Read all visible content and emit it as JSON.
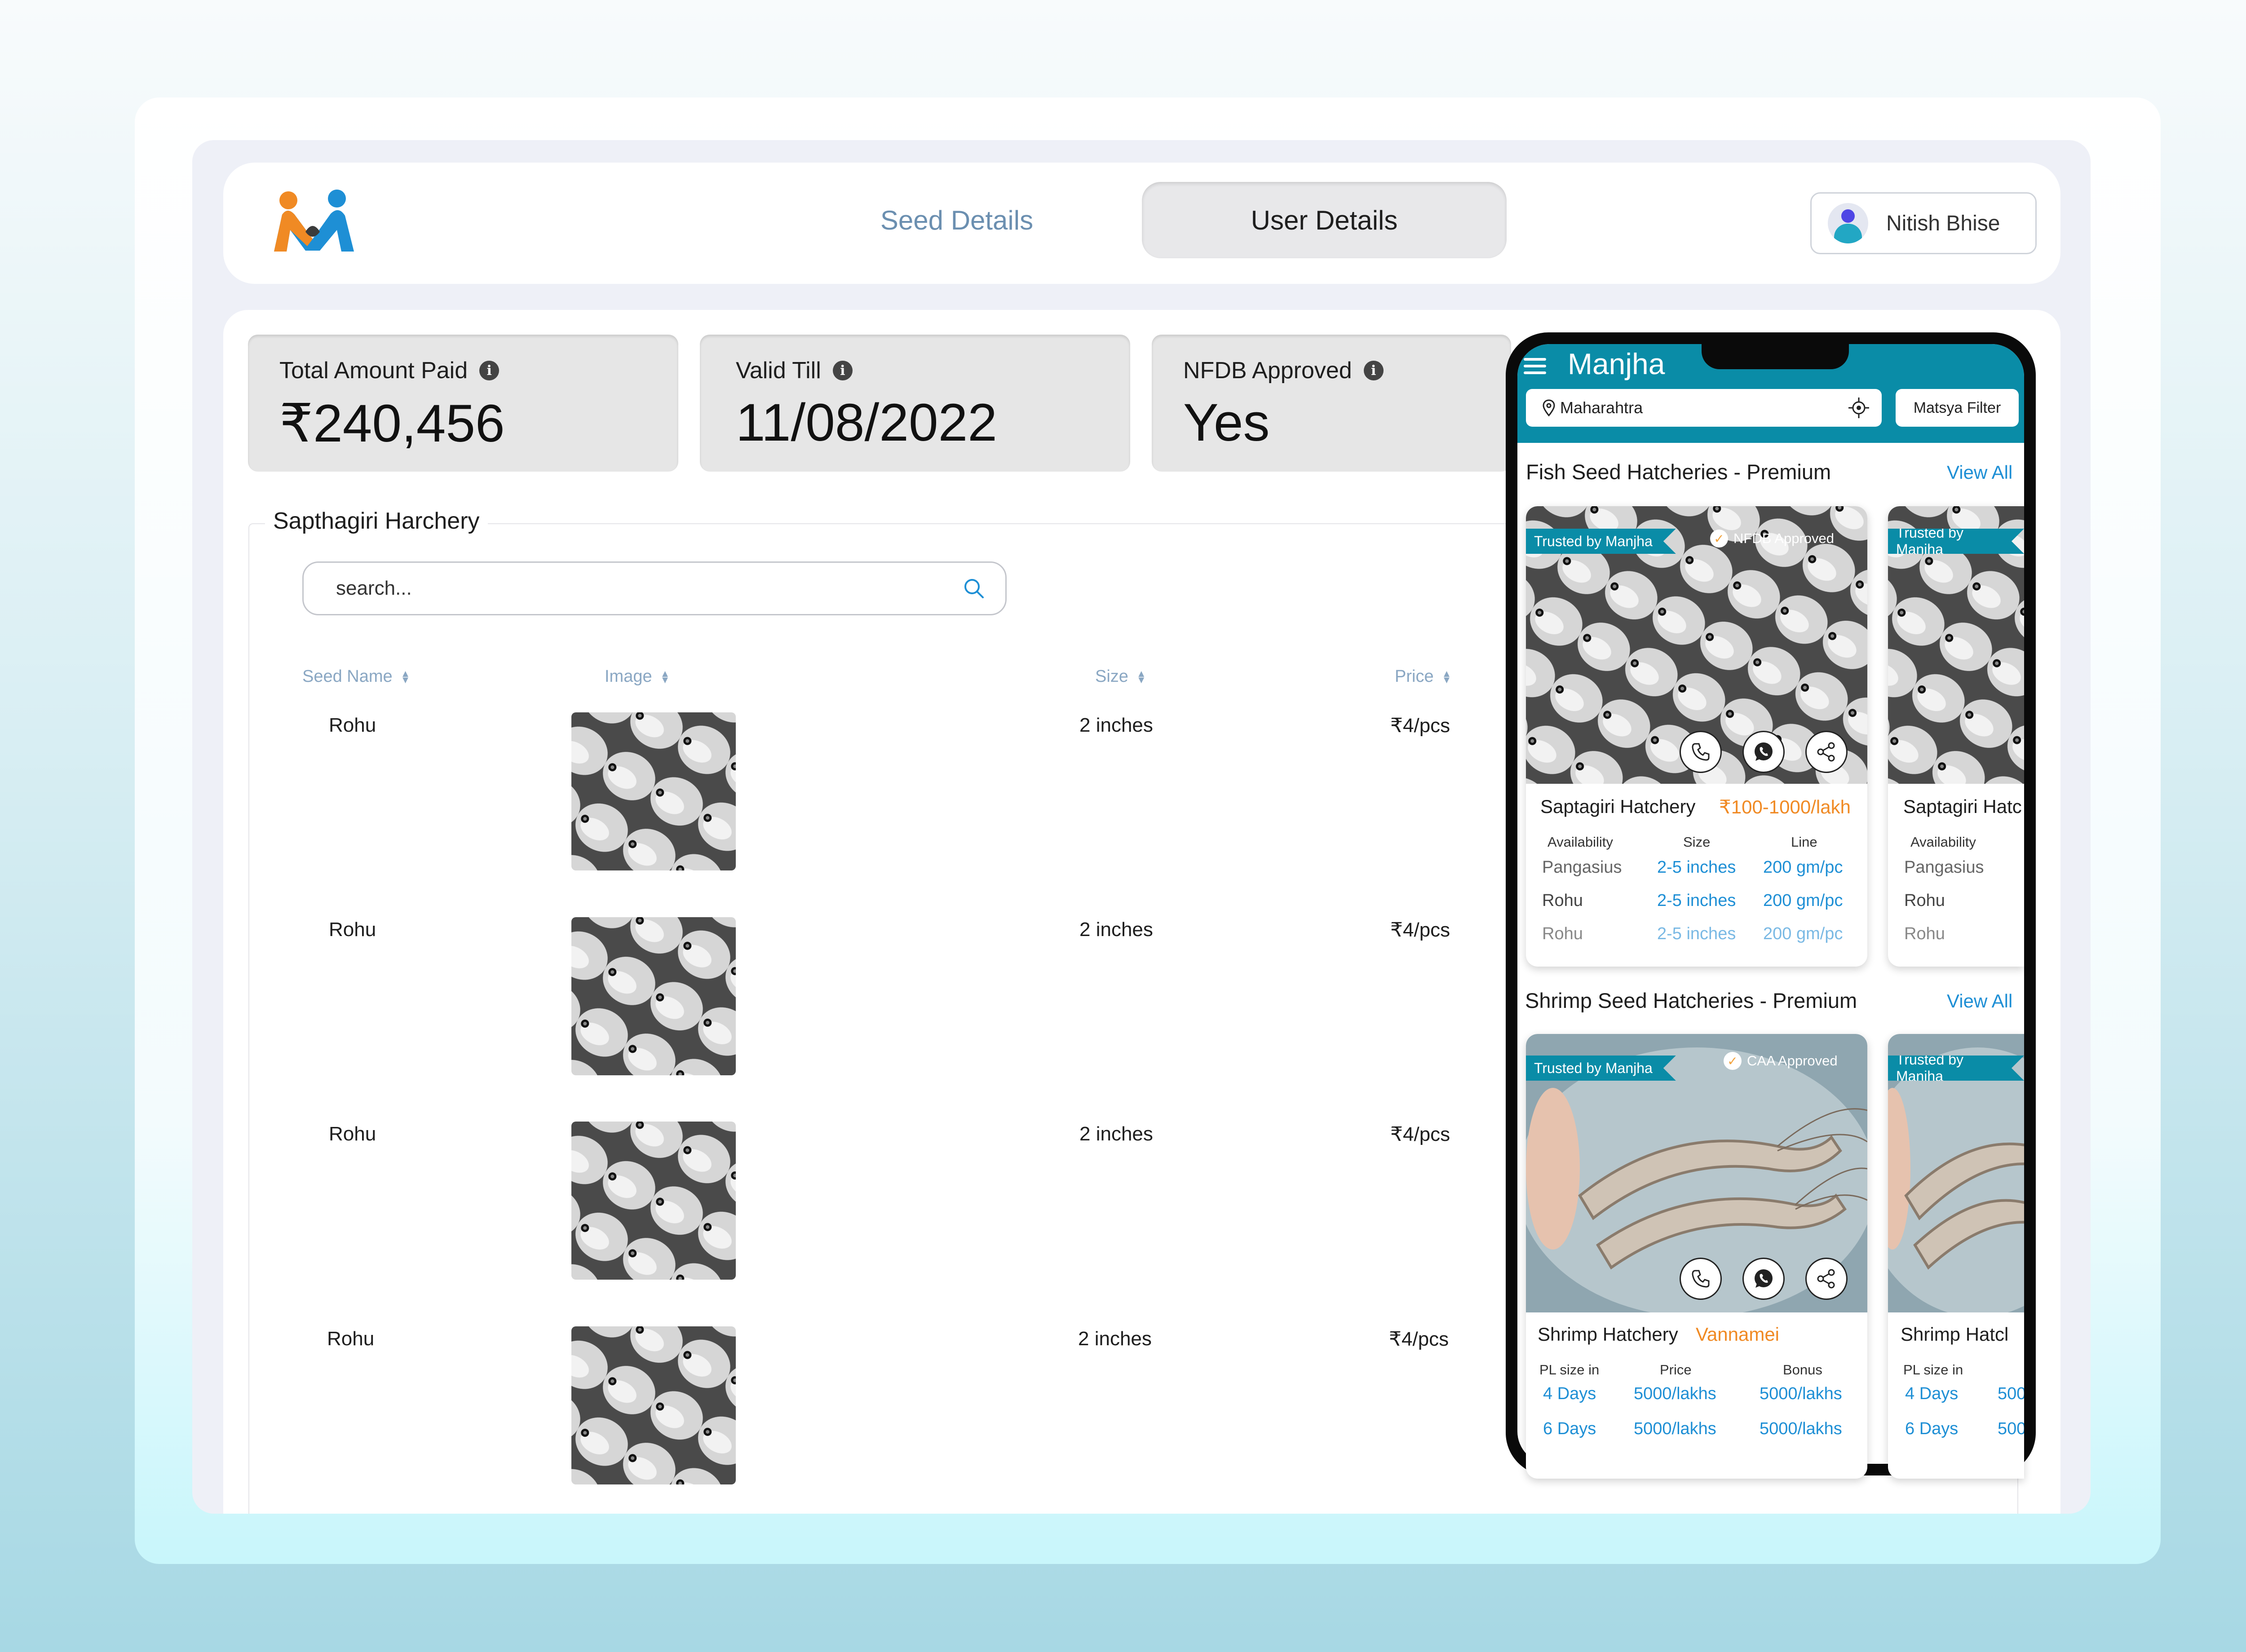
{
  "nav": {
    "tabs": [
      "Seed Details",
      "User Details"
    ],
    "active_tab": "User Details",
    "user_name": "Nitish Bhise"
  },
  "stats": [
    {
      "label": "Total Amount Paid",
      "value": "₹240,456"
    },
    {
      "label": "Valid Till",
      "value": "11/08/2022"
    },
    {
      "label": "NFDB Approved",
      "value": "Yes"
    }
  ],
  "table": {
    "title": "Sapthagiri Harchery",
    "search_placeholder": "search...",
    "columns": [
      "Seed Name",
      "Image",
      "Size",
      "Price"
    ],
    "rows": [
      {
        "name": "Rohu",
        "size": "2 inches",
        "price": "₹4/pcs"
      },
      {
        "name": "Rohu",
        "size": "2 inches",
        "price": "₹4/pcs"
      },
      {
        "name": "Rohu",
        "size": "2 inches",
        "price": "₹4/pcs"
      },
      {
        "name": "Rohu",
        "size": "2 inches",
        "price": "₹4/pcs"
      }
    ]
  },
  "mobile": {
    "app_name": "Manjha",
    "location": "Maharahtra",
    "filter_label": "Matsya Filter",
    "fish_section": {
      "title": "Fish Seed Hatcheries - Premium",
      "view_all": "View All",
      "card": {
        "ribbon": "Trusted by Manjha",
        "badge": "NFDB Approved",
        "name": "Saptagiri Hatchery",
        "price": "₹100-1000/lakh",
        "headers": [
          "Availability",
          "Size",
          "Line"
        ],
        "rows": [
          [
            "Pangasius",
            "2-5 inches",
            "200 gm/pc"
          ],
          [
            "Rohu",
            "2-5 inches",
            "200 gm/pc"
          ],
          [
            "Rohu",
            "2-5 inches",
            "200 gm/pc"
          ]
        ]
      },
      "card2": {
        "ribbon": "Trusted by Manjha",
        "name": "Saptagiri Hatc",
        "header": "Availability",
        "rows": [
          "Pangasius",
          "Rohu",
          "Rohu"
        ]
      }
    },
    "shrimp_section": {
      "title": "Shrimp Seed Hatcheries - Premium",
      "view_all": "View All",
      "card": {
        "ribbon": "Trusted by Manjha",
        "badge": "CAA Approved",
        "name": "Shrimp Hatchery",
        "species": "Vannamei",
        "headers": [
          "PL size in",
          "Price",
          "Bonus"
        ],
        "rows": [
          [
            "4 Days",
            "5000/lakhs",
            "5000/lakhs"
          ],
          [
            "6 Days",
            "5000/lakhs",
            "5000/lakhs"
          ]
        ]
      },
      "card2": {
        "ribbon": "Trusted by Manjha",
        "name": "Shrimp Hatcl",
        "header": "PL size in",
        "rows": [
          [
            "4 Days",
            "500"
          ],
          [
            "6 Days",
            "500"
          ]
        ]
      }
    }
  },
  "colors": {
    "accent": "#0a8ca7",
    "link": "#1e8fd5",
    "price": "#f08a24",
    "header_text": "#6b8fb0"
  },
  "icons": [
    "manjha-logo",
    "info-icon",
    "search-icon",
    "sort-icon",
    "menu-icon",
    "location-pin-icon",
    "gps-target-icon",
    "phone-call-icon",
    "whatsapp-icon",
    "share-icon",
    "check-badge-icon",
    "user-avatar-icon"
  ]
}
